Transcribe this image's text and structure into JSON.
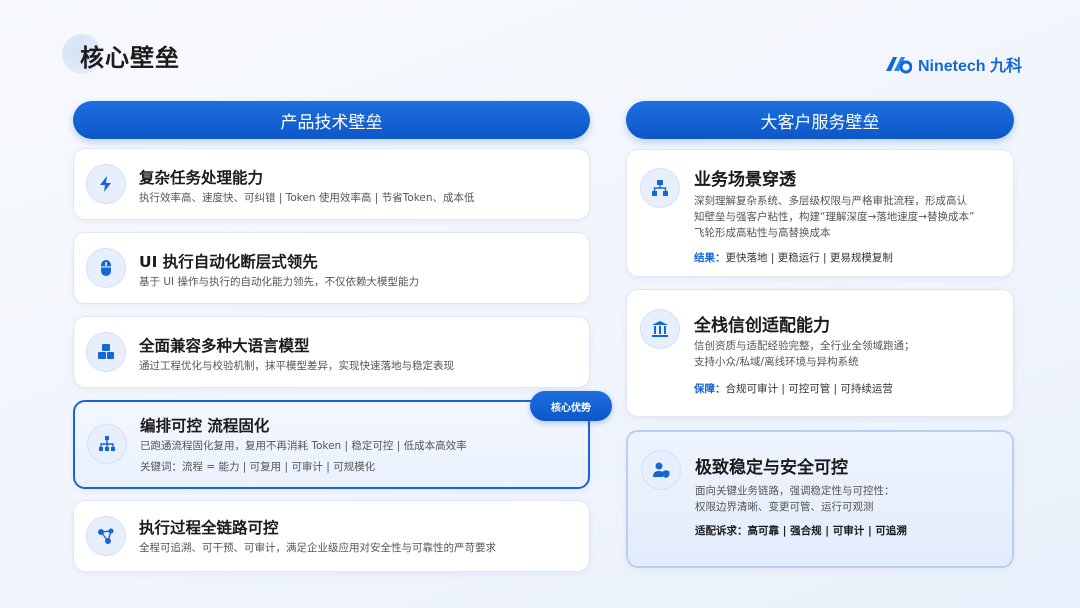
{
  "page": {
    "title": "核心壁垒"
  },
  "logo": {
    "text": "Ninetech 九科"
  },
  "left": {
    "header": "产品技术壁垒",
    "badge": "核心优势",
    "cards": [
      {
        "title": "复杂任务处理能力",
        "desc": "执行效率高、速度快、可纠错 | Token 使用效率高 | 节省Token、成本低",
        "icon": "lightning-icon"
      },
      {
        "title": "UI 执行自动化断层式领先",
        "desc": "基于 UI 操作与执行的自动化能力领先，不仅依赖大模型能力",
        "icon": "mouse-icon"
      },
      {
        "title": "全面兼容多种大语言模型",
        "desc": "通过工程优化与校验机制，抹平模型差异，实现快速落地与稳定表现",
        "icon": "cubes-icon"
      },
      {
        "title": "编排可控 流程固化",
        "desc": "已跑通流程固化复用，复用不再消耗 Token | 稳定可控 | 低成本高效率",
        "desc2": "关键词：流程 = 能力 | 可复用 | 可审计 | 可规模化",
        "icon": "sitemap-icon"
      },
      {
        "title": "执行过程全链路可控",
        "desc": "全程可追溯、可干预、可审计，满足企业级应用对安全性与可靠性的严苛要求",
        "icon": "nodes-icon"
      }
    ]
  },
  "right": {
    "header": "大客户服务壁垒",
    "cards": [
      {
        "title": "业务场景穿透",
        "desc": [
          "深刻理解复杂系统、多层级权限与严格审批流程，形成高认",
          "知壁垒与强客户粘性，构建“理解深度→落地速度→替换成本”",
          "飞轮形成高粘性与高替换成本"
        ],
        "result_label": "结果：",
        "result": "更快落地 | 更稳运行 | 更易规模复制",
        "icon": "org-chart-icon"
      },
      {
        "title": "全栈信创适配能力",
        "desc": [
          "信创资质与适配经验完整，全行业全领域跑通；",
          "支持小众/私域/离线环境与异构系统"
        ],
        "result_label": "保障：",
        "result": "合规可审计 | 可控可管 | 可持续运营",
        "icon": "bank-icon"
      },
      {
        "title": "极致稳定与安全可控",
        "desc": [
          "面向关键业务链路，强调稳定性与可控性：",
          "权限边界清晰、变更可管、运行可观测"
        ],
        "result": "适配诉求：高可靠 | 强合规 | 可审计 | 可追溯",
        "icon": "user-shield-icon"
      }
    ]
  },
  "colors": {
    "accent": "#1566d6",
    "accent_dark": "#0d57c8"
  }
}
